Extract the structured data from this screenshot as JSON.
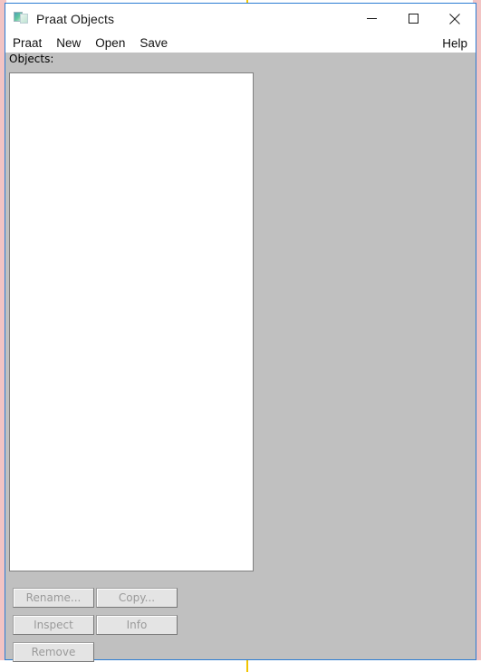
{
  "window": {
    "title": "Praat Objects",
    "icon": "praat-app-icon",
    "controls": [
      {
        "name": "minimize-button",
        "glyph": "minimize-icon"
      },
      {
        "name": "maximize-button",
        "glyph": "maximize-icon"
      },
      {
        "name": "close-button",
        "glyph": "close-icon"
      }
    ]
  },
  "menubar": {
    "items": [
      {
        "label": "Praat"
      },
      {
        "label": "New"
      },
      {
        "label": "Open"
      },
      {
        "label": "Save"
      }
    ],
    "help_label": "Help"
  },
  "client": {
    "objects_label": "Objects:",
    "objects_list_items": []
  },
  "buttons": [
    {
      "label": "Rename...",
      "enabled": false
    },
    {
      "label": "Copy...",
      "enabled": false
    },
    {
      "label": "Inspect",
      "enabled": false
    },
    {
      "label": "Info",
      "enabled": false
    },
    {
      "label": "Remove",
      "enabled": false
    }
  ],
  "colors": {
    "window_border": "#2b7cd3",
    "client_background": "#c0c0c0",
    "list_background": "#ffffff",
    "titlebar_background": "#ffffff",
    "disabled_text": "#9a9a9a",
    "backdrop_pink": "#f2c4c4",
    "backdrop_yellow": "#f2c500"
  }
}
